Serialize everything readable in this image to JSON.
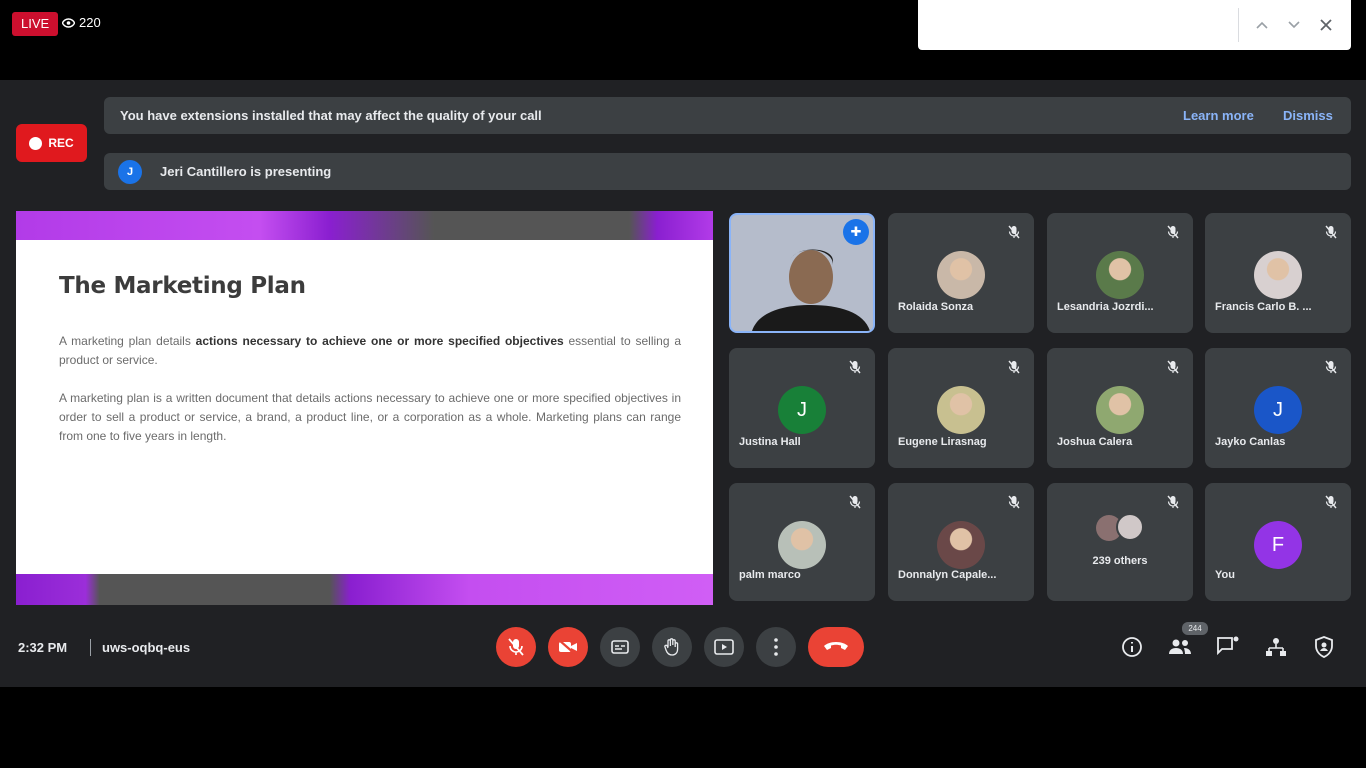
{
  "live": {
    "label": "LIVE",
    "viewers": "220"
  },
  "find": {
    "value": "",
    "placeholder": ""
  },
  "rec_label": "REC",
  "banner_ext": {
    "text": "You have extensions installed that may affect the quality of your call",
    "learn_more": "Learn more",
    "dismiss": "Dismiss"
  },
  "presenting": {
    "avatar": "J",
    "text": "Jeri Cantillero is presenting"
  },
  "slide": {
    "title": "The Marketing Plan",
    "p1_start": "A marketing plan details ",
    "p1_bold": "actions necessary to achieve one or more specified objectives",
    "p1_end": " essential to selling a product or service.",
    "p2": "A marketing plan is a written document that details actions necessary to achieve one or more specified objectives in order to sell a product or service, a brand, a product line, or a corporation as a whole. Marketing plans can range from one to five years in length."
  },
  "participants": [
    {
      "name": "",
      "kind": "video"
    },
    {
      "name": "Rolaida Sonza",
      "kind": "photo",
      "color": "#c9b8a8"
    },
    {
      "name": "Lesandria Jozrdi...",
      "kind": "photo",
      "color": "#5a7a4a"
    },
    {
      "name": "Francis Carlo B. ...",
      "kind": "photo",
      "color": "#d8d0d0"
    },
    {
      "name": "Justina Hall",
      "kind": "letter",
      "letter": "J",
      "color": "#188038"
    },
    {
      "name": "Eugene Lirasnag",
      "kind": "photo",
      "color": "#c8c090"
    },
    {
      "name": "Joshua Calera",
      "kind": "photo",
      "color": "#8fa870"
    },
    {
      "name": "Jayko Canlas",
      "kind": "letter",
      "letter": "J",
      "color": "#1a56c8"
    },
    {
      "name": "palm marco",
      "kind": "photo",
      "color": "#b8c0b8"
    },
    {
      "name": "Donnalyn Capale...",
      "kind": "photo",
      "color": "#6a4848"
    },
    {
      "name": "239 others",
      "kind": "others",
      "color": "#d0c8c8"
    },
    {
      "name": "You",
      "kind": "letter",
      "letter": "F",
      "color": "#9334e6"
    }
  ],
  "bottom": {
    "time": "2:32 PM",
    "code": "uws-oqbq-eus",
    "people_count": "244"
  },
  "colors": {
    "accent": "#8ab4f8",
    "danger": "#ea4335",
    "surface": "#3c4043",
    "background": "#202124"
  }
}
